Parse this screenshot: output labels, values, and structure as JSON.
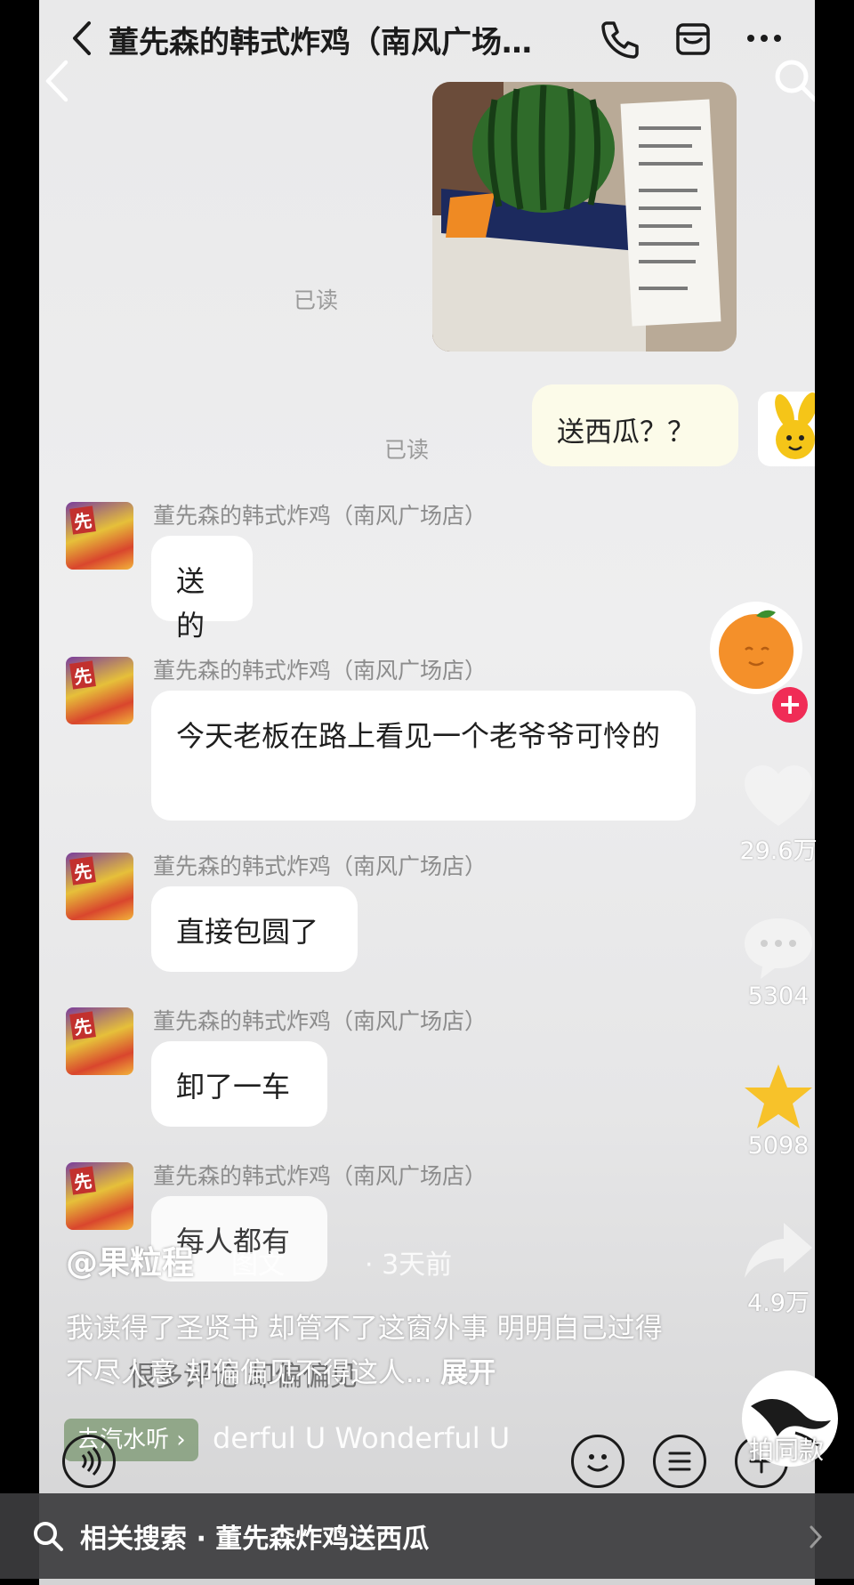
{
  "chat": {
    "title": "董先森的韩式炸鸡（南风广场…",
    "read_label": "已读",
    "my_message": "送西瓜？？",
    "sender_name": "董先森的韩式炸鸡（南风广场店）",
    "shop_avatar_tag": "先",
    "messages": [
      {
        "text": "送的"
      },
      {
        "text": "今天老板在路上看见一个老爷爷可怜的"
      },
      {
        "text": "直接包圆了"
      },
      {
        "text": "卸了一车"
      },
      {
        "text": "每人都有"
      }
    ]
  },
  "video": {
    "author": "@果粒程",
    "post_type": "图文",
    "post_time": "· 3天前",
    "caption": "我读得了圣贤书 却管不了这窗外事 明明自己过得不尽人意 却偏偏见不得这人...",
    "expand_label": "展开",
    "ghost_comment": "很多评论 却偏偏见",
    "music_chip": "去汽水听 ›",
    "music_text": "derful U    Wonderful U",
    "same_style_label": "拍同款"
  },
  "actions": {
    "likes": "29.6万",
    "comments": "5304",
    "favorites": "5098",
    "shares": "4.9万"
  },
  "related_search": {
    "label": "相关搜索 · 董先森炸鸡送西瓜"
  },
  "colors": {
    "bubble_mine": "#fcfbe9",
    "bubble_theirs": "#ffffff",
    "follow_plus": "#f02c56",
    "star": "#f7c22a"
  }
}
